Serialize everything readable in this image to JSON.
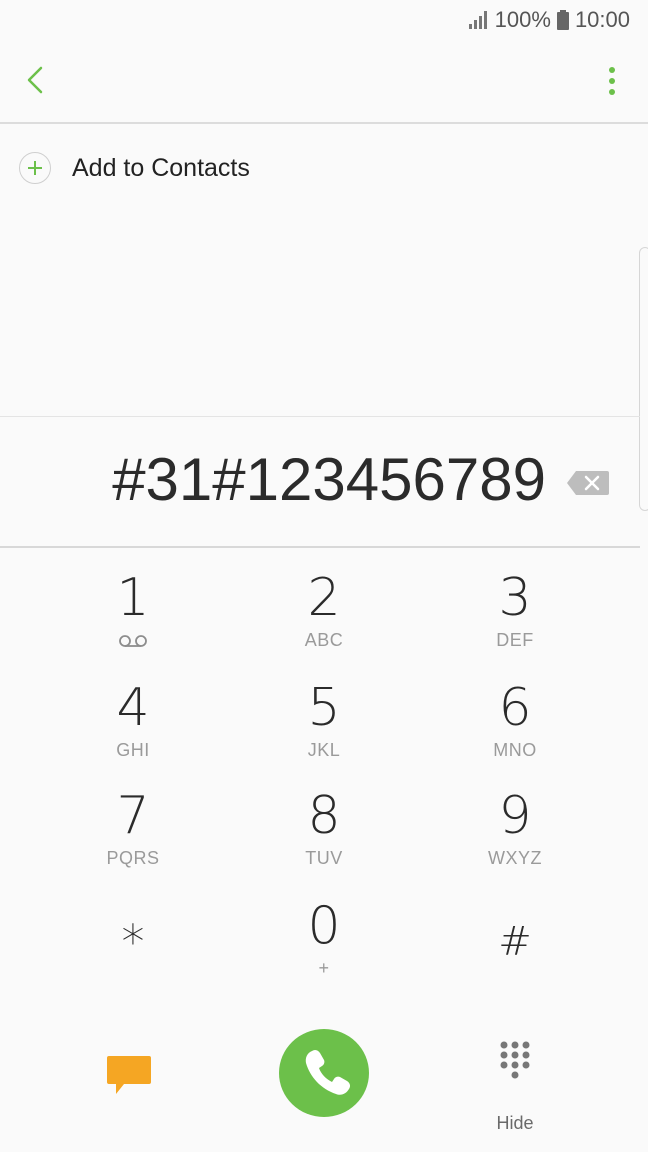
{
  "status_bar": {
    "battery_percent": "100%",
    "time": "10:00"
  },
  "add_contacts": {
    "label": "Add to Contacts"
  },
  "dialed_number": "#31#123456789",
  "keypad": [
    {
      "digit": "1",
      "letters": ""
    },
    {
      "digit": "2",
      "letters": "ABC"
    },
    {
      "digit": "3",
      "letters": "DEF"
    },
    {
      "digit": "4",
      "letters": "GHI"
    },
    {
      "digit": "5",
      "letters": "JKL"
    },
    {
      "digit": "6",
      "letters": "MNO"
    },
    {
      "digit": "7",
      "letters": "PQRS"
    },
    {
      "digit": "8",
      "letters": "TUV"
    },
    {
      "digit": "9",
      "letters": "WXYZ"
    },
    {
      "digit": "*",
      "letters": ""
    },
    {
      "digit": "0",
      "letters": "+"
    },
    {
      "digit": "#",
      "letters": ""
    }
  ],
  "bottom_bar": {
    "hide_label": "Hide"
  },
  "colors": {
    "accent": "#6cc04a",
    "message": "#f5a623"
  },
  "icons": {
    "back": "back-arrow-icon",
    "more": "more-vert-icon",
    "add": "plus-icon",
    "backspace": "backspace-icon",
    "voicemail": "voicemail-icon",
    "message": "message-icon",
    "call": "phone-icon",
    "hide": "dialpad-icon"
  }
}
